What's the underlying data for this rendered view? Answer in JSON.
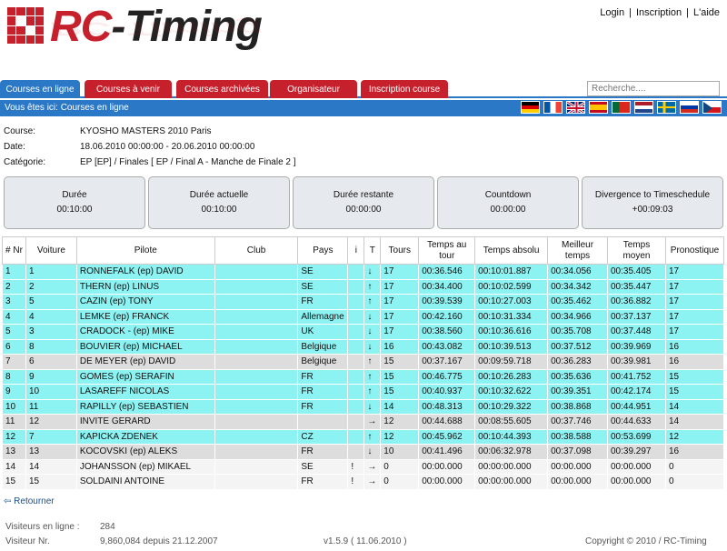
{
  "brand": {
    "name_red": "RC",
    "name_dark": "-Timing"
  },
  "top_links": {
    "login": "Login",
    "inscription": "Inscription",
    "aide": "L'aide",
    "sep": "|"
  },
  "nav": {
    "tabs": [
      "Courses en ligne",
      "Courses à venir",
      "Courses archivées",
      "Organisateur",
      "Inscription course"
    ],
    "search_placeholder": "Recherche....",
    "active_color": "#2a78c6",
    "tab_color": "#c6202d"
  },
  "breadcrumb": "Vous êtes ici: Courses en ligne",
  "flags": [
    "germany-flag",
    "france-flag",
    "uk-flag",
    "spain-flag",
    "portugal-flag",
    "netherlands-flag",
    "sweden-flag",
    "russia-flag",
    "czech-flag"
  ],
  "race": {
    "course_label": "Course:",
    "course": "KYOSHO MASTERS 2010 Paris",
    "date_label": "Date:",
    "date": "18.06.2010 00:00:00 - 20.06.2010 00:00:00",
    "cat_label": "Catégorie:",
    "category": "EP [EP] / Finales [ EP / Final A - Manche de Finale 2 ]"
  },
  "timers": [
    {
      "label": "Durée",
      "value": "00:10:00"
    },
    {
      "label": "Durée actuelle",
      "value": "00:10:00"
    },
    {
      "label": "Durée restante",
      "value": "00:00:00"
    },
    {
      "label": "Countdown",
      "value": "00:00:00"
    },
    {
      "label": "Divergence to Timeschedule",
      "value": "+00:09:03"
    }
  ],
  "table": {
    "headers": [
      "# Nr",
      "Voiture",
      "Pilote",
      "Club",
      "Pays",
      "i",
      "T",
      "Tours",
      "Temps au tour",
      "Temps absolu",
      "Meilleur temps",
      "Temps moyen",
      "Pronostique"
    ],
    "rows": [
      {
        "style": "cyan",
        "cells": [
          "1",
          "1",
          "RONNEFALK (ep) DAVID",
          "",
          "SE",
          "",
          "↓",
          "17",
          "00:36.546",
          "00:10:01.887",
          "00:34.056",
          "00:35.405",
          "17"
        ]
      },
      {
        "style": "cyan",
        "cells": [
          "2",
          "2",
          "THERN (ep) LINUS",
          "",
          "SE",
          "",
          "↑",
          "17",
          "00:34.400",
          "00:10:02.599",
          "00:34.342",
          "00:35.447",
          "17"
        ]
      },
      {
        "style": "cyan",
        "cells": [
          "3",
          "5",
          "CAZIN (ep) TONY",
          "",
          "FR",
          "",
          "↑",
          "17",
          "00:39.539",
          "00:10:27.003",
          "00:35.462",
          "00:36.882",
          "17"
        ]
      },
      {
        "style": "cyan",
        "cells": [
          "4",
          "4",
          "LEMKE (ep) FRANCK",
          "",
          "Allemagne",
          "",
          "↓",
          "17",
          "00:42.160",
          "00:10:31.334",
          "00:34.966",
          "00:37.137",
          "17"
        ]
      },
      {
        "style": "cyan",
        "cells": [
          "5",
          "3",
          "CRADOCK - (ep) MIKE",
          "",
          "UK",
          "",
          "↓",
          "17",
          "00:38.560",
          "00:10:36.616",
          "00:35.708",
          "00:37.448",
          "17"
        ]
      },
      {
        "style": "cyan",
        "cells": [
          "6",
          "8",
          "BOUVIER (ep) MICHAEL",
          "",
          "Belgique",
          "",
          "↓",
          "16",
          "00:43.082",
          "00:10:39.513",
          "00:37.512",
          "00:39.969",
          "16"
        ]
      },
      {
        "style": "gray",
        "cells": [
          "7",
          "6",
          "DE MEYER (ep) DAVID",
          "",
          "Belgique",
          "",
          "↑",
          "15",
          "00:37.167",
          "00:09:59.718",
          "00:36.283",
          "00:39.981",
          "16"
        ]
      },
      {
        "style": "cyan",
        "cells": [
          "8",
          "9",
          "GOMES (ep) SERAFIN",
          "",
          "FR",
          "",
          "↑",
          "15",
          "00:46.775",
          "00:10:26.283",
          "00:35.636",
          "00:41.752",
          "15"
        ]
      },
      {
        "style": "cyan",
        "cells": [
          "9",
          "10",
          "LASAREFF NICOLAS",
          "",
          "FR",
          "",
          "↑",
          "15",
          "00:40.937",
          "00:10:32.622",
          "00:39.351",
          "00:42.174",
          "15"
        ]
      },
      {
        "style": "cyan",
        "cells": [
          "10",
          "11",
          "RAPILLY (ep) SEBASTIEN",
          "",
          "FR",
          "",
          "↓",
          "14",
          "00:48.313",
          "00:10:29.322",
          "00:38.868",
          "00:44.951",
          "14"
        ]
      },
      {
        "style": "gray",
        "cells": [
          "11",
          "12",
          "INVITE GERARD",
          "",
          "",
          "",
          "→",
          "12",
          "00:44.688",
          "00:08:55.605",
          "00:37.746",
          "00:44.633",
          "14"
        ]
      },
      {
        "style": "cyan",
        "cells": [
          "12",
          "7",
          "KAPICKA ZDENEK",
          "",
          "CZ",
          "",
          "↑",
          "12",
          "00:45.962",
          "00:10:44.393",
          "00:38.588",
          "00:53.699",
          "12"
        ]
      },
      {
        "style": "gray",
        "cells": [
          "13",
          "13",
          "KOCOVSKI (ep) ALEKS",
          "",
          "FR",
          "",
          "↓",
          "10",
          "00:41.496",
          "00:06:32.978",
          "00:37.098",
          "00:39.297",
          "16"
        ]
      },
      {
        "style": "white",
        "cells": [
          "14",
          "14",
          "JOHANSSON (ep) MIKAEL",
          "",
          "SE",
          "!",
          "→",
          "0",
          "00:00.000",
          "00:00:00.000",
          "00:00.000",
          "00:00.000",
          "0"
        ]
      },
      {
        "style": "white",
        "cells": [
          "15",
          "15",
          "SOLDAINI ANTOINE",
          "",
          "FR",
          "!",
          "→",
          "0",
          "00:00.000",
          "00:00:00.000",
          "00:00.000",
          "00:00.000",
          "0"
        ]
      }
    ]
  },
  "retour": "Retourner",
  "footer": {
    "online_label": "Visiteurs en ligne :",
    "online": "284",
    "visitor_label": "Visiteur Nr.",
    "visitor": "9,860,084 depuis 21.12.2007",
    "version": "v1.5.9 ( 11.06.2010 )",
    "copyright": "Copyright © 2010 / RC-Timing"
  }
}
